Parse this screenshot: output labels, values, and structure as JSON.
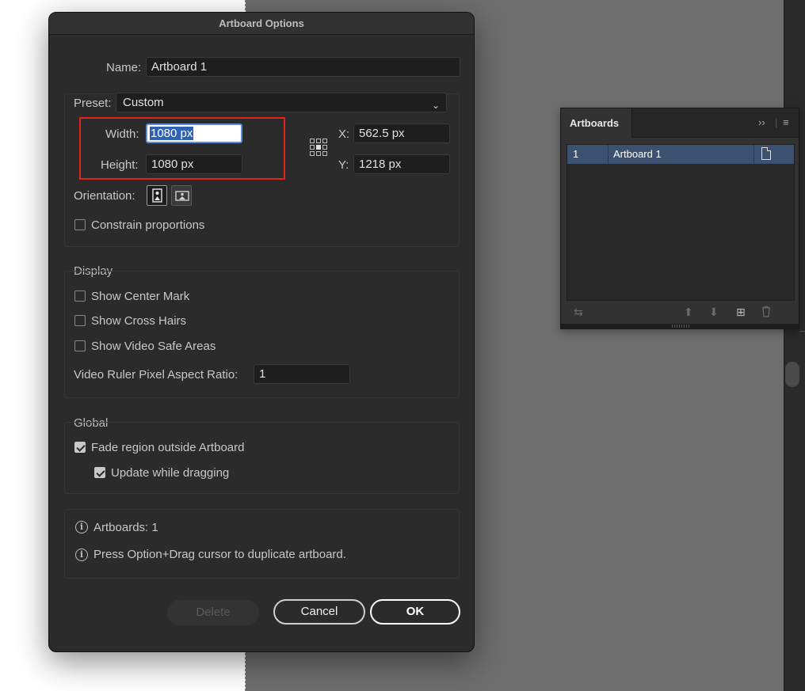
{
  "dialog": {
    "title": "Artboard Options",
    "name_label": "Name:",
    "name_value": "Artboard 1",
    "preset_label": "Preset:",
    "preset_value": "Custom",
    "width_label": "Width:",
    "width_value": "1080 px",
    "height_label": "Height:",
    "height_value": "1080 px",
    "x_label": "X:",
    "x_value": "562.5 px",
    "y_label": "Y:",
    "y_value": "1218 px",
    "orientation_label": "Orientation:",
    "constrain_label": "Constrain proportions",
    "constrain_checked": false,
    "display": {
      "title": "Display",
      "show_center_mark": "Show Center Mark",
      "show_cross_hairs": "Show Cross Hairs",
      "show_video_safe": "Show Video Safe Areas",
      "ratio_label": "Video Ruler Pixel Aspect Ratio:",
      "ratio_value": "1"
    },
    "global": {
      "title": "Global",
      "fade_label": "Fade region outside Artboard",
      "fade_checked": true,
      "update_label": "Update while dragging",
      "update_checked": true
    },
    "info": {
      "artboards_count": "Artboards: 1",
      "tip": "Press Option+Drag cursor to duplicate artboard."
    },
    "buttons": {
      "delete": "Delete",
      "cancel": "Cancel",
      "ok": "OK"
    }
  },
  "panel": {
    "tab": "Artboards",
    "rows": [
      {
        "number": "1",
        "name": "Artboard 1"
      }
    ]
  },
  "icons": {
    "reference_point": "reference-point-grid-icon",
    "portrait": "portrait-orientation-icon",
    "landscape": "landscape-orientation-icon",
    "info": "info-icon",
    "dropdown": "chevron-down-icon",
    "panel_expand": "double-chevron-right-icon",
    "panel_menu": "hamburger-menu-icon",
    "artboard_options": "artboard-options-icon",
    "rearrange": "rearrange-icon",
    "move_up": "arrow-up-icon",
    "move_down": "arrow-down-icon",
    "new_artboard": "new-artboard-icon",
    "delete": "trash-icon"
  },
  "colors": {
    "highlight_box": "#e0251b",
    "selection": "#2f62b3",
    "panel_row_selected": "#3c5170"
  }
}
